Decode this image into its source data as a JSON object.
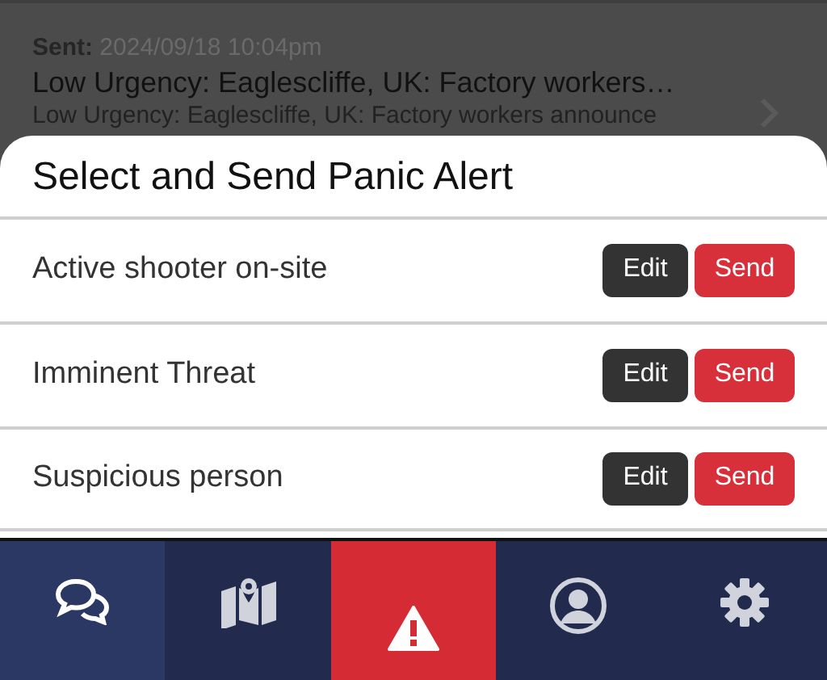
{
  "message": {
    "sent_label": "Sent:",
    "sent_time": "2024/09/18 10:04pm",
    "title": "Low Urgency: Eaglescliffe, UK: Factory workers…",
    "preview": "Low Urgency: Eaglescliffe, UK: Factory workers announce"
  },
  "sheet": {
    "title": "Select and Send Panic Alert",
    "alerts": [
      {
        "label": "Active shooter on-site",
        "edit": "Edit",
        "send": "Send"
      },
      {
        "label": "Imminent Threat",
        "edit": "Edit",
        "send": "Send"
      },
      {
        "label": "Suspicious person",
        "edit": "Edit",
        "send": "Send"
      }
    ]
  },
  "tabs": [
    {
      "kind": "messages",
      "selected": true
    },
    {
      "kind": "map",
      "selected": false
    },
    {
      "kind": "alert",
      "selected": false
    },
    {
      "kind": "profile",
      "selected": false
    },
    {
      "kind": "settings",
      "selected": false
    }
  ]
}
